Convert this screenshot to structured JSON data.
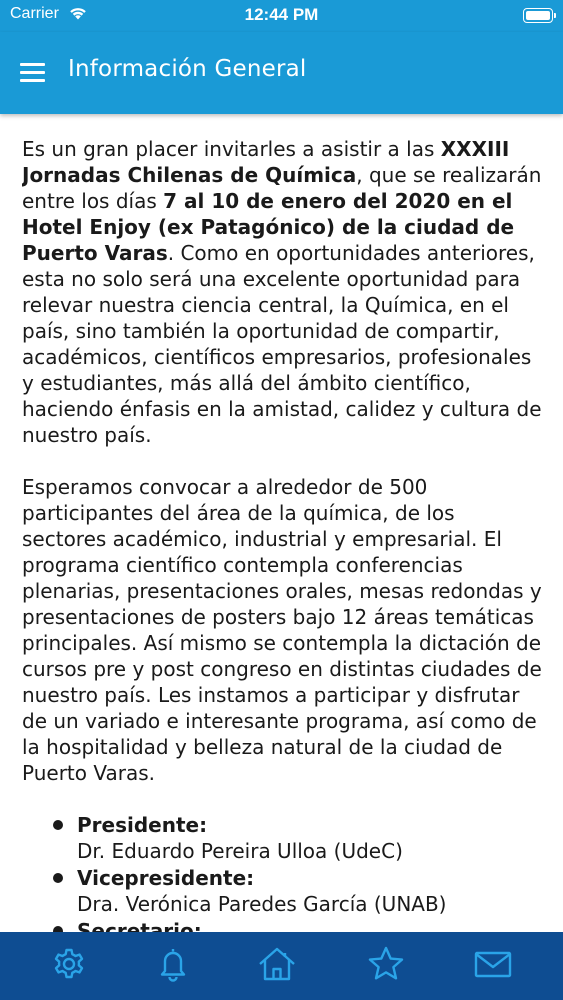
{
  "status_bar": {
    "carrier": "Carrier",
    "time": "12:44 PM",
    "wifi_icon": "wifi-icon",
    "battery_icon": "battery-icon"
  },
  "header": {
    "title": "Información General",
    "menu_icon": "hamburger-menu-icon"
  },
  "paragraph1": {
    "t1": "Es un gran placer invitarles a asistir a las ",
    "b1": "XXXIII Jornadas Chilenas de Química",
    "t2": ", que se realizarán entre los días ",
    "b2": "7 al 10 de enero del 2020 en el Hotel Enjoy (ex Patagónico) de la ciudad de Puerto Varas",
    "t3": ". Como en oportunidades anteriores, esta no solo será una excelente oportunidad para relevar nuestra ciencia central, la Química, en el país, sino también la oportunidad de compartir, académicos, científicos empresarios, profesionales y estudiantes, más allá del ámbito científico, haciendo énfasis en la amistad, calidez y cultura de nuestro país."
  },
  "paragraph2": "Esperamos convocar a alrededor de 500 participantes del área de la química, de los sectores académico, industrial y empresarial. El programa científico contempla conferencias plenarias, presentaciones orales, mesas redondas y presentaciones de posters bajo 12 áreas temáticas principales. Así mismo se contempla la dictación de cursos pre y post congreso en distintas ciudades de nuestro país. Les instamos a participar y disfrutar de un variado e interesante programa, así como de la hospitalidad y belleza natural de la ciudad de Puerto Varas.",
  "officers": [
    {
      "role": "Presidente:",
      "name": "Dr. Eduardo Pereira Ulloa (UdeC)"
    },
    {
      "role": "Vicepresidente:",
      "name": "Dra. Verónica Paredes García (UNAB)"
    },
    {
      "role": "Secretario:",
      "name": ""
    }
  ],
  "tab_bar": {
    "tabs": [
      {
        "icon": "settings-gear-icon"
      },
      {
        "icon": "notifications-bell-icon"
      },
      {
        "icon": "home-icon"
      },
      {
        "icon": "favorites-star-icon"
      },
      {
        "icon": "mail-envelope-icon"
      }
    ]
  },
  "colors": {
    "app_bar": "#1a9ad6",
    "tab_bar": "#0e4d92",
    "text": "#1a1a1a"
  }
}
